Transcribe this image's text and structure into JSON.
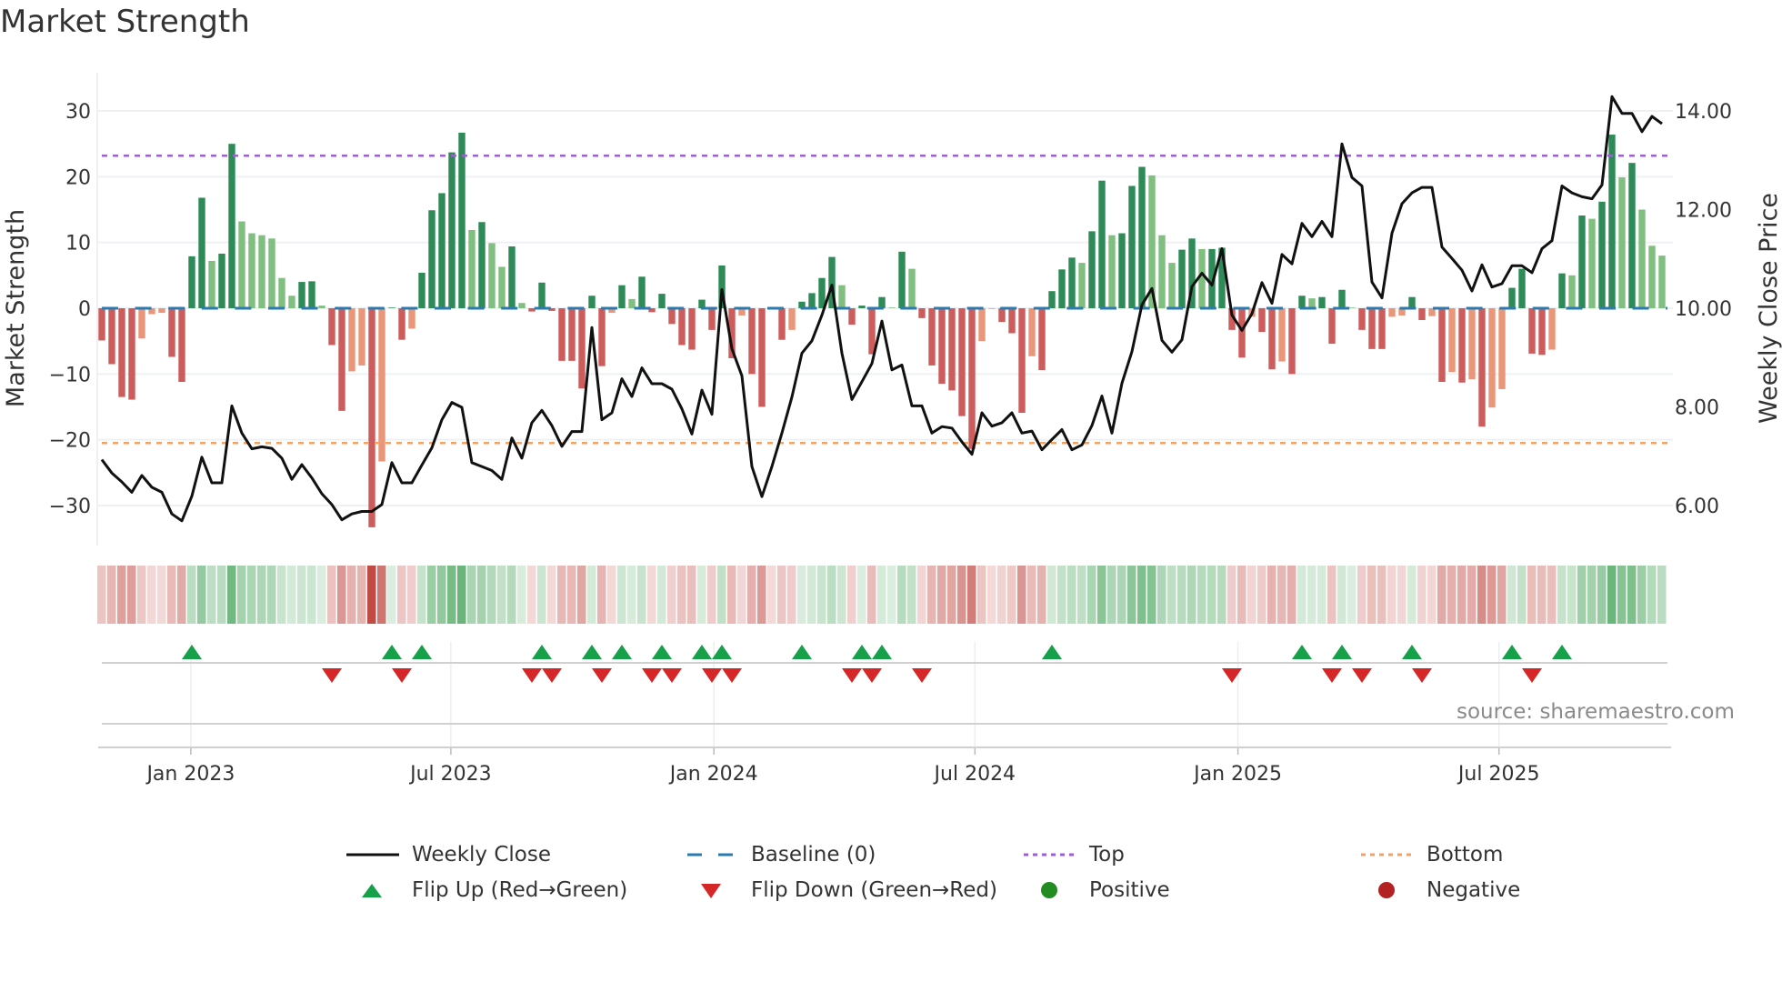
{
  "chart_data": {
    "type": "bar",
    "title": "Market Strength",
    "ylabel": "Market Strength",
    "y2label": "Weekly Close Price",
    "ylim": [
      -35,
      35
    ],
    "y2lim": [
      5.333,
      14.667
    ],
    "yticks": [
      30,
      20,
      10,
      0,
      -10,
      -20,
      -30
    ],
    "ytick_labels": [
      "30",
      "20",
      "10",
      "0",
      "−10",
      "−20",
      "−30"
    ],
    "y2ticks": [
      14,
      12,
      10,
      8,
      6
    ],
    "y2tick_labels": [
      "14.00",
      "12.00",
      "10.00",
      "8.00",
      "6.00"
    ],
    "xticks": [
      {
        "label": "Jan 2023",
        "week_index": 8.9
      },
      {
        "label": "Jul 2023",
        "week_index": 34.9
      },
      {
        "label": "Jan 2024",
        "week_index": 61.2
      },
      {
        "label": "Jul 2024",
        "week_index": 87.3
      },
      {
        "label": "Jan 2025",
        "week_index": 113.6
      },
      {
        "label": "Jul 2025",
        "week_index": 139.7
      }
    ],
    "top_level": 23.2,
    "bottom_level": -20.5,
    "baseline": 0,
    "strength": [
      -4.9,
      -8.5,
      -13.5,
      -13.9,
      -4.6,
      -0.9,
      -0.7,
      -7.4,
      -11.2,
      7.9,
      16.8,
      7.2,
      8.3,
      25.0,
      13.2,
      11.4,
      11.1,
      10.6,
      4.6,
      1.9,
      4.0,
      4.1,
      0.4,
      -5.6,
      -15.6,
      -9.6,
      -8.7,
      -33.3,
      -23.3,
      0.1,
      -4.8,
      -3.1,
      5.4,
      14.9,
      17.5,
      23.7,
      26.7,
      11.9,
      13.1,
      9.9,
      6.3,
      9.4,
      0.8,
      -0.5,
      3.9,
      -0.4,
      -8.0,
      -8.0,
      -12.2,
      1.9,
      -8.8,
      -0.7,
      3.5,
      1.4,
      4.8,
      -0.6,
      2.2,
      -2.4,
      -5.6,
      -6.3,
      1.3,
      -3.3,
      6.5,
      -7.6,
      -1.1,
      -10.0,
      -15.0,
      -0.1,
      -4.8,
      -3.3,
      1.0,
      2.3,
      4.6,
      7.8,
      3.5,
      -2.5,
      0.4,
      -7.0,
      1.7,
      0.1,
      8.6,
      6.0,
      -1.5,
      -8.7,
      -11.5,
      -12.5,
      -16.4,
      -21.4,
      -5.0,
      -0.1,
      -2.1,
      -3.8,
      -15.9,
      -7.3,
      -9.4,
      2.6,
      5.9,
      7.7,
      6.9,
      11.7,
      19.4,
      11.1,
      11.4,
      18.6,
      21.5,
      20.2,
      11.1,
      6.9,
      8.9,
      10.6,
      9.0,
      9.0,
      9.2,
      -3.3,
      -7.5,
      -1.3,
      -3.6,
      -9.3,
      -8.1,
      -10.0,
      1.9,
      1.5,
      1.7,
      -5.4,
      2.8,
      0.1,
      -3.3,
      -6.2,
      -6.2,
      -1.3,
      -1.1,
      1.7,
      -1.8,
      -1.2,
      -11.2,
      -9.7,
      -11.3,
      -10.8,
      -18.0,
      -15.1,
      -12.3,
      3.1,
      6.0,
      -6.9,
      -7.1,
      -6.3,
      5.3,
      5.0,
      14.1,
      13.6,
      16.2,
      26.4,
      19.9,
      22.1,
      15.0,
      9.5,
      8.0
    ],
    "weekly_close": [
      6.93,
      6.66,
      6.48,
      6.27,
      6.61,
      6.37,
      6.27,
      5.83,
      5.69,
      6.19,
      6.98,
      6.46,
      6.46,
      8.02,
      7.47,
      7.15,
      7.19,
      7.16,
      6.96,
      6.53,
      6.83,
      6.56,
      6.24,
      6.02,
      5.71,
      5.83,
      5.88,
      5.88,
      6.02,
      6.87,
      6.46,
      6.46,
      6.82,
      7.17,
      7.74,
      8.09,
      7.99,
      6.87,
      6.79,
      6.71,
      6.53,
      7.37,
      6.96,
      7.68,
      7.93,
      7.62,
      7.2,
      7.5,
      7.5,
      9.61,
      7.74,
      7.88,
      8.57,
      8.21,
      8.79,
      8.47,
      8.47,
      8.36,
      7.96,
      7.45,
      8.34,
      7.85,
      10.38,
      9.18,
      8.63,
      6.79,
      6.18,
      6.79,
      7.47,
      8.2,
      9.09,
      9.34,
      9.86,
      10.47,
      9.09,
      8.15,
      8.51,
      8.88,
      9.74,
      8.75,
      8.85,
      8.02,
      8.02,
      7.47,
      7.6,
      7.57,
      7.29,
      7.04,
      7.88,
      7.61,
      7.68,
      7.88,
      7.47,
      7.51,
      7.13,
      7.34,
      7.54,
      7.13,
      7.23,
      7.62,
      8.22,
      7.47,
      8.48,
      9.12,
      10.07,
      10.4,
      9.35,
      9.11,
      9.36,
      10.44,
      10.71,
      10.47,
      11.21,
      9.86,
      9.55,
      9.89,
      10.52,
      10.1,
      11.09,
      10.9,
      11.72,
      11.45,
      11.76,
      11.45,
      13.33,
      12.65,
      12.48,
      10.53,
      10.21,
      11.52,
      12.12,
      12.34,
      12.45,
      12.45,
      11.24,
      11.01,
      10.77,
      10.35,
      10.88,
      10.43,
      10.5,
      10.86,
      10.86,
      10.72,
      11.21,
      11.37,
      12.48,
      12.34,
      12.26,
      12.22,
      12.5,
      14.29,
      13.95,
      13.95,
      13.58,
      13.89,
      13.74
    ],
    "flip_up": [
      9,
      29,
      32,
      44,
      49,
      52,
      56,
      60,
      62,
      70,
      76,
      78,
      95,
      120,
      124,
      131,
      141,
      146
    ],
    "flip_down": [
      23,
      30,
      43,
      45,
      50,
      55,
      57,
      61,
      63,
      75,
      77,
      82,
      113,
      123,
      126,
      132,
      143
    ],
    "colors": {
      "pos_rising": "#2e8b57",
      "pos_falling": "#80bf80",
      "neg_falling": "#cd5c5c",
      "neg_rising": "#e9967a",
      "close": "#111111",
      "baseline": "#2b7bb0",
      "top": "#9c5fd6",
      "bottom": "#f4a261",
      "flip_up": "#16a04a",
      "flip_down": "#d62728",
      "positive": "#228b22",
      "negative": "#b22222",
      "heat_pos": "#4fa861",
      "heat_neg": "#c24a44"
    },
    "legend": [
      {
        "key": "close",
        "label": "Weekly Close"
      },
      {
        "key": "baseline",
        "label": "Baseline (0)"
      },
      {
        "key": "top",
        "label": "Top"
      },
      {
        "key": "bottom",
        "label": "Bottom"
      },
      {
        "key": "flip_up",
        "label": "Flip Up (Red→Green)"
      },
      {
        "key": "flip_down",
        "label": "Flip Down (Green→Red)"
      },
      {
        "key": "positive",
        "label": "Positive"
      },
      {
        "key": "negative",
        "label": "Negative"
      }
    ],
    "legend_position": "bottom",
    "source": "source: sharemaestro.com"
  }
}
